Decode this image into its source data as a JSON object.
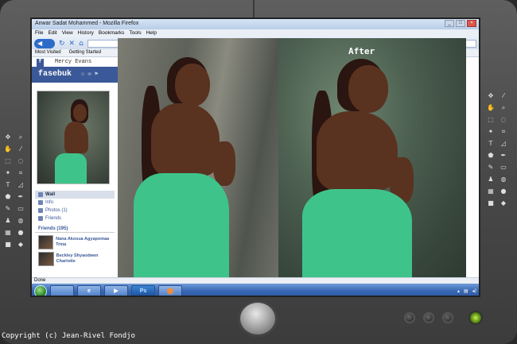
{
  "window": {
    "title": "Anwar Sadat Mohammed - Mozilla Firefox",
    "controls": [
      "_",
      "□",
      "×"
    ]
  },
  "menu": [
    "File",
    "Edit",
    "View",
    "History",
    "Bookmarks",
    "Tools",
    "Help"
  ],
  "bookmarks": [
    "Most Visited",
    "Getting Started"
  ],
  "facebook": {
    "tab_name": "Mercy Evans",
    "logo": "fasebuk",
    "links": [
      "Wall",
      "Info",
      "Photos (1)",
      "Friends"
    ],
    "friends_header": "Friends (195)",
    "friends": [
      {
        "name": "Nana Akosua Agyapomaa Trina"
      },
      {
        "name": "Beckley Shyaodwen Charlotte"
      }
    ]
  },
  "comparison": {
    "after_label": "After"
  },
  "status": "Done",
  "taskbar": {
    "apps": [
      {
        "label": "",
        "icon": "folder-icon"
      },
      {
        "label": "e",
        "icon": "ie-icon"
      },
      {
        "label": "▶",
        "icon": "media-icon"
      },
      {
        "label": "Ps",
        "icon": "photoshop-icon"
      },
      {
        "label": "◉",
        "icon": "firefox-icon"
      }
    ]
  },
  "copyright": "Copyright (c) Jean-Rivel Fondjo",
  "colors": {
    "facebook_blue": "#3b5998",
    "dress_green": "#3ec48b",
    "taskbar_blue": "#3766b2"
  }
}
